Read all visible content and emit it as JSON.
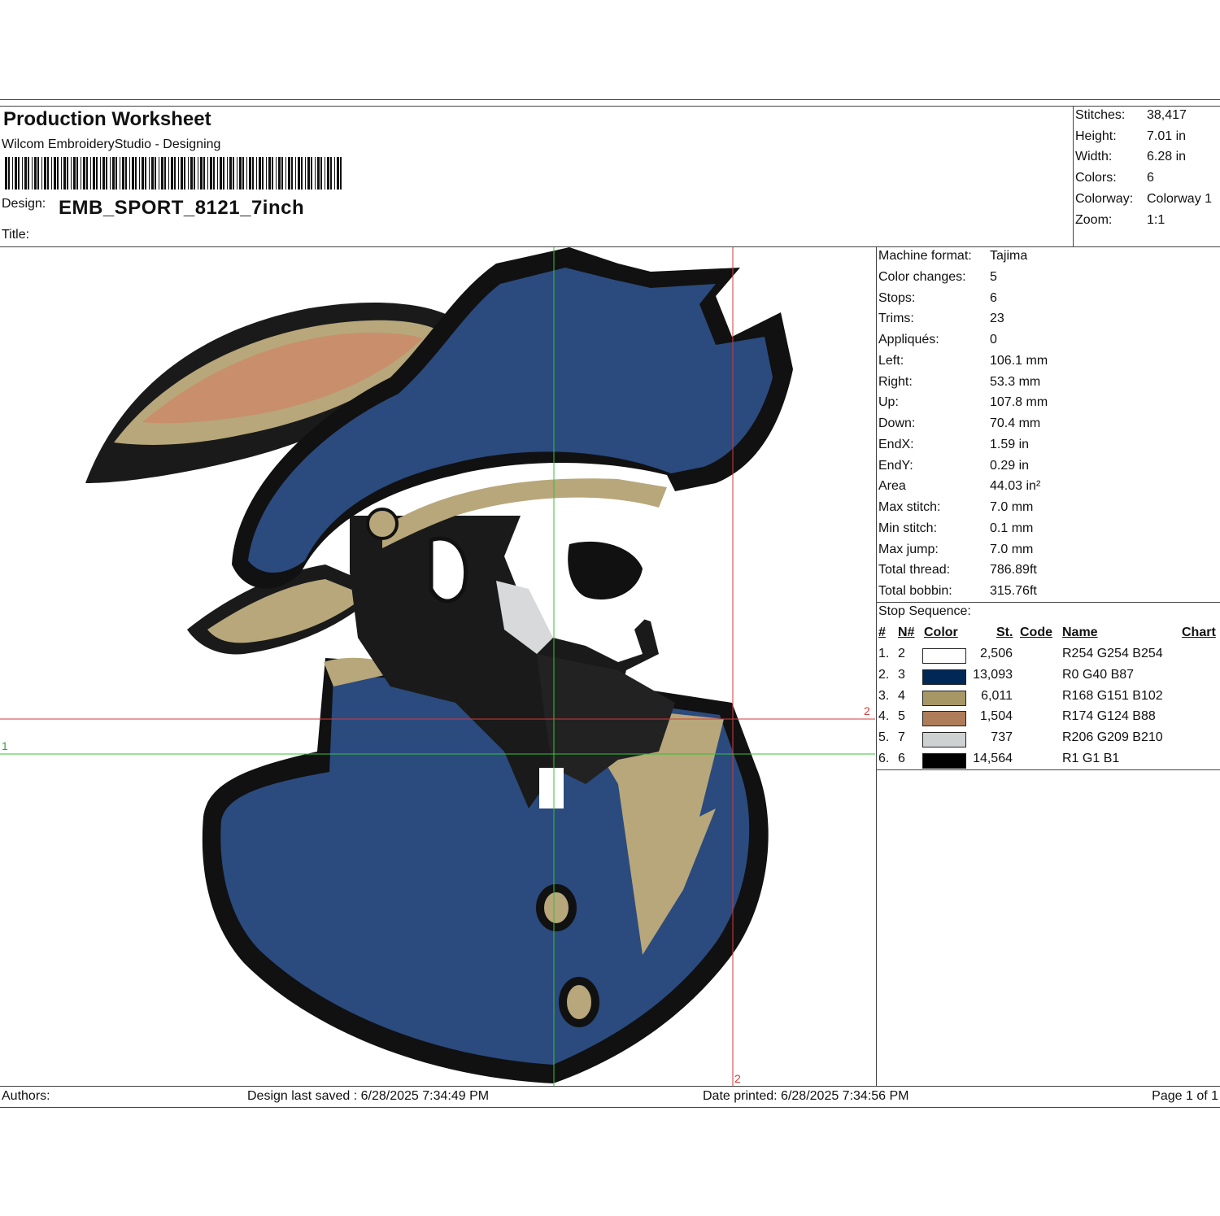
{
  "header": {
    "title": "Production Worksheet",
    "software": "Wilcom EmbroideryStudio - Designing",
    "design_label": "Design:",
    "design_name": "EMB_SPORT_8121_7inch",
    "title_label": "Title:",
    "title_value": ""
  },
  "summary": [
    {
      "label": "Stitches:",
      "value": "38,417"
    },
    {
      "label": "Height:",
      "value": "7.01 in"
    },
    {
      "label": "Width:",
      "value": "6.28 in"
    },
    {
      "label": "Colors:",
      "value": "6"
    },
    {
      "label": "Colorway:",
      "value": "Colorway 1"
    },
    {
      "label": "Zoom:",
      "value": "1:1"
    }
  ],
  "machine": [
    {
      "label": "Machine format:",
      "value": "Tajima"
    },
    {
      "label": "Color changes:",
      "value": "5"
    },
    {
      "label": "Stops:",
      "value": "6"
    },
    {
      "label": "Trims:",
      "value": "23"
    },
    {
      "label": "Appliqués:",
      "value": "0"
    },
    {
      "label": "Left:",
      "value": "106.1 mm"
    },
    {
      "label": "Right:",
      "value": "53.3 mm"
    },
    {
      "label": "Up:",
      "value": "107.8 mm"
    },
    {
      "label": "Down:",
      "value": "70.4 mm"
    },
    {
      "label": "EndX:",
      "value": "1.59 in"
    },
    {
      "label": "EndY:",
      "value": "0.29 in"
    },
    {
      "label": "Area",
      "value": " 44.03 in²"
    },
    {
      "label": "Max stitch:",
      "value": "7.0 mm"
    },
    {
      "label": "Min stitch:",
      "value": "0.1 mm"
    },
    {
      "label": "Max jump:",
      "value": "7.0 mm"
    },
    {
      "label": "Total thread:",
      "value": "786.89ft"
    },
    {
      "label": "Total bobbin:",
      "value": "315.76ft"
    }
  ],
  "stop_sequence": {
    "label": "Stop Sequence:",
    "headers": {
      "num": "#",
      "n": "N#",
      "color": "Color",
      "st": "St.",
      "code": "Code",
      "name": "Name",
      "chart": "Chart"
    },
    "rows": [
      {
        "num": "1.",
        "n": "2",
        "color": "#fefefe",
        "st": "2,506",
        "name": "R254 G254 B254"
      },
      {
        "num": "2.",
        "n": "3",
        "color": "#002857",
        "st": "13,093",
        "name": "R0 G40 B87"
      },
      {
        "num": "3.",
        "n": "4",
        "color": "#a89766",
        "st": "6,011",
        "name": "R168 G151 B102"
      },
      {
        "num": "4.",
        "n": "5",
        "color": "#ae7c58",
        "st": "1,504",
        "name": "R174 G124 B88"
      },
      {
        "num": "5.",
        "n": "7",
        "color": "#ced1d2",
        "st": "737",
        "name": "R206 G209 B210"
      },
      {
        "num": "6.",
        "n": "6",
        "color": "#010101",
        "st": "14,564",
        "name": "R1 G1 B1"
      }
    ]
  },
  "guides": {
    "label_1": "1",
    "label_2a": "2",
    "label_2b": "2"
  },
  "footer": {
    "authors": "Authors:",
    "saved": "Design last saved : 6/28/2025 7:34:49 PM",
    "printed": "Date printed: 6/28/2025 7:34:56 PM",
    "page": "Page 1 of 1"
  },
  "colors": {
    "navy": "#2b4a7e",
    "tan": "#b7a77a",
    "feather": "#c98e6b",
    "outline": "#111111",
    "guide_red": "#d23b3b",
    "guide_green": "#34c23a"
  }
}
